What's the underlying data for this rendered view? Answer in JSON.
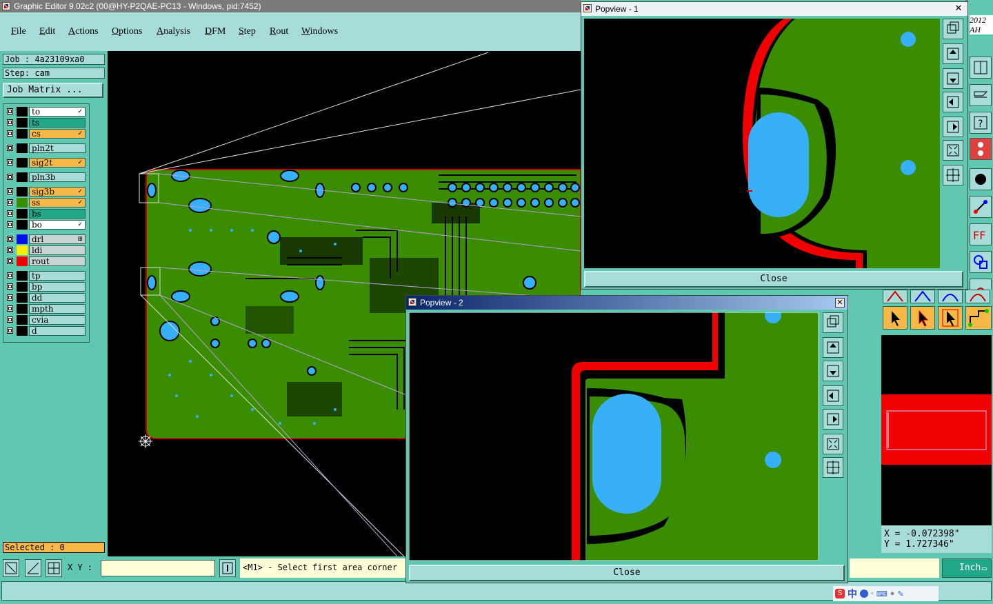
{
  "window": {
    "title": "Graphic Editor 9.02c2 (00@HY-P2QAE-PC13 - Windows, pid:7452)"
  },
  "menu": [
    "File",
    "Edit",
    "Actions",
    "Options",
    "Analysis",
    "DFM",
    "Step",
    "Rout",
    "Windows"
  ],
  "job": {
    "job_label": "Job : 4a23109xa0",
    "step_label": "Step: cam",
    "matrix_button": "Job Matrix ..."
  },
  "layers": [
    {
      "name": "to",
      "style": "white",
      "swatch": "#000000",
      "flag": "✓"
    },
    {
      "name": "ts",
      "style": "teal",
      "swatch": "#000000",
      "flag": ""
    },
    {
      "name": "cs",
      "style": "orange",
      "swatch": "#000000",
      "flag": "✓"
    },
    {
      "name": "pln2t",
      "style": "",
      "swatch": "#000000",
      "flag": ""
    },
    {
      "name": "sig2t",
      "style": "orange",
      "swatch": "#000000",
      "flag": "✓"
    },
    {
      "name": "pln3b",
      "style": "",
      "swatch": "#000000",
      "flag": ""
    },
    {
      "name": "sig3b",
      "style": "orange",
      "swatch": "#000000",
      "flag": "✓"
    },
    {
      "name": "ss",
      "style": "orange",
      "swatch": "#3a8c00",
      "flag": "✓"
    },
    {
      "name": "bs",
      "style": "teal",
      "swatch": "#000000",
      "flag": ""
    },
    {
      "name": "bo",
      "style": "white",
      "swatch": "#000000",
      "flag": "✓"
    },
    {
      "name": "drl",
      "style": "grey",
      "swatch": "#0010e0",
      "flag": "⊞"
    },
    {
      "name": "ldi",
      "style": "grey",
      "swatch": "#f8f000",
      "flag": ""
    },
    {
      "name": "rout",
      "style": "grey",
      "swatch": "#f00000",
      "flag": ""
    },
    {
      "name": "tp",
      "style": "",
      "swatch": "#000000",
      "flag": ""
    },
    {
      "name": "bp",
      "style": "",
      "swatch": "#000000",
      "flag": ""
    },
    {
      "name": "dd",
      "style": "",
      "swatch": "#000000",
      "flag": ""
    },
    {
      "name": "mpth",
      "style": "",
      "swatch": "#000000",
      "flag": ""
    },
    {
      "name": "cvia",
      "style": "",
      "swatch": "#000000",
      "flag": ""
    },
    {
      "name": "d",
      "style": "",
      "swatch": "#000000",
      "flag": ""
    }
  ],
  "selected": "Selected : 0",
  "xy_label": "X Y :",
  "message": "<M1> - Select first area corner",
  "units": "Inch",
  "coords": {
    "x": "X = -0.072398\"",
    "y": "Y = 1.727346\""
  },
  "corner_text": {
    "line1": "2012",
    "line2": "AH"
  },
  "popview1": {
    "title": "Popview - 1",
    "close_label": "Close"
  },
  "popview2": {
    "title": "Popview - 2",
    "close_label": "Close"
  },
  "colors": {
    "copper": "#3a8c00",
    "drill": "#38b0f8",
    "rout": "#f00000",
    "panel": "#60c8b0"
  }
}
